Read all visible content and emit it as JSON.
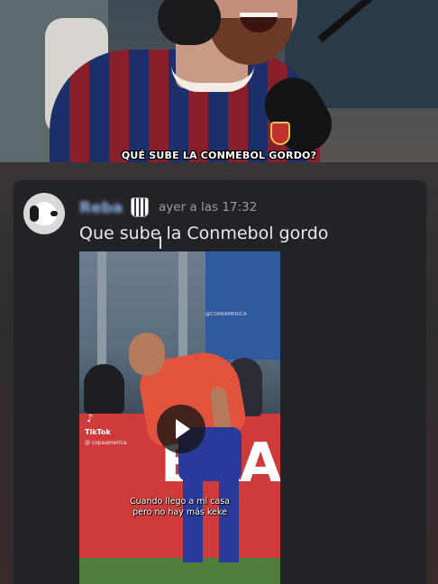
{
  "stream": {
    "caption": "QUÉ SUBE LA CONMEBOL GORDO?"
  },
  "message": {
    "username": "Reba",
    "timestamp": "ayer a las 17:32",
    "text": "Que sube la Conmebol gordo",
    "avatar_icon": "snoopy-avatar",
    "role_icon": "club-crest-icon"
  },
  "video": {
    "platform": "TikTok",
    "handle": "@ copaamerica",
    "watermark": "@COPAAMERICA",
    "banner_text": "BRA",
    "subtitle_line1": "Cuando llego a mi casa",
    "subtitle_line2": "pero no hay más keke",
    "play_icon": "play-icon"
  },
  "colors": {
    "card_bg": "#222326",
    "username": "#8fb4e8",
    "timestamp": "#9a9ca3",
    "message_text": "#e8e9eb"
  }
}
